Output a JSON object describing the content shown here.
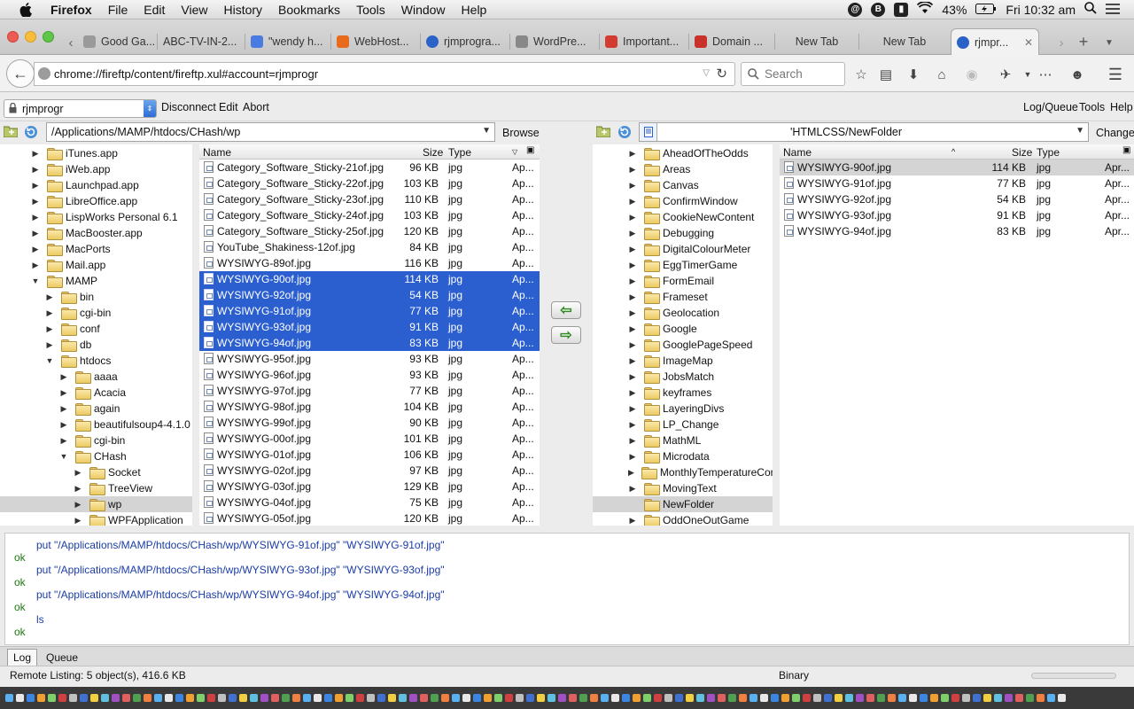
{
  "menubar": {
    "app": "Firefox",
    "items": [
      "File",
      "Edit",
      "View",
      "History",
      "Bookmarks",
      "Tools",
      "Window",
      "Help"
    ],
    "battery": "43%",
    "clock": "Fri 10:32 am"
  },
  "tabs": [
    {
      "label": "Good Ga...",
      "color": "#999999"
    },
    {
      "label": "ABC-TV-IN-2...",
      "color": "#aaaaaa"
    },
    {
      "label": "\"wendy h...",
      "color": "#4a7be0"
    },
    {
      "label": "WebHost...",
      "color": "#e86a1c"
    },
    {
      "label": "rjmprogra...",
      "color": "#2a62c8"
    },
    {
      "label": "WordPre...",
      "color": "#888888"
    },
    {
      "label": "Important...",
      "color": "#d23b2f"
    },
    {
      "label": "Domain ...",
      "color": "#c8322a"
    },
    {
      "label": "New Tab",
      "color": ""
    },
    {
      "label": "New Tab",
      "color": ""
    },
    {
      "label": "rjmpr...",
      "color": "#2a62c8"
    }
  ],
  "nav": {
    "url": "chrome://fireftp/content/fireftp.xul#account=rjmprogr",
    "search_placeholder": "Search"
  },
  "toolbar": {
    "account": "rjmprogr",
    "disconnect": "Disconnect",
    "edit": "Edit",
    "abort": "Abort",
    "logqueue": "Log/Queue",
    "tools": "Tools",
    "help": "Help"
  },
  "local": {
    "path": "/Applications/MAMP/htdocs/CHash/wp",
    "browse": "Browse",
    "tree": [
      {
        "label": "iTunes.app",
        "level": 0,
        "state": "closed"
      },
      {
        "label": "iWeb.app",
        "level": 0,
        "state": "closed"
      },
      {
        "label": "Launchpad.app",
        "level": 0,
        "state": "closed"
      },
      {
        "label": "LibreOffice.app",
        "level": 0,
        "state": "closed"
      },
      {
        "label": "LispWorks Personal 6.1",
        "level": 0,
        "state": "closed"
      },
      {
        "label": "MacBooster.app",
        "level": 0,
        "state": "closed"
      },
      {
        "label": "MacPorts",
        "level": 0,
        "state": "closed"
      },
      {
        "label": "Mail.app",
        "level": 0,
        "state": "closed"
      },
      {
        "label": "MAMP",
        "level": 0,
        "state": "open"
      },
      {
        "label": "bin",
        "level": 1,
        "state": "closed"
      },
      {
        "label": "cgi-bin",
        "level": 1,
        "state": "closed"
      },
      {
        "label": "conf",
        "level": 1,
        "state": "closed"
      },
      {
        "label": "db",
        "level": 1,
        "state": "closed"
      },
      {
        "label": "htdocs",
        "level": 1,
        "state": "open"
      },
      {
        "label": "aaaa",
        "level": 2,
        "state": "closed"
      },
      {
        "label": "Acacia",
        "level": 2,
        "state": "closed"
      },
      {
        "label": "again",
        "level": 2,
        "state": "closed"
      },
      {
        "label": "beautifulsoup4-4.1.0",
        "level": 2,
        "state": "closed"
      },
      {
        "label": "cgi-bin",
        "level": 2,
        "state": "closed"
      },
      {
        "label": "CHash",
        "level": 2,
        "state": "open"
      },
      {
        "label": "Socket",
        "level": 3,
        "state": "closed"
      },
      {
        "label": "TreeView",
        "level": 3,
        "state": "closed"
      },
      {
        "label": "wp",
        "level": 3,
        "state": "closed",
        "current": true
      },
      {
        "label": "WPFApplication",
        "level": 3,
        "state": "closed"
      }
    ],
    "headers": {
      "name": "Name",
      "size": "Size",
      "type": "Type"
    },
    "files": [
      {
        "name": "Category_Software_Sticky-21of.jpg",
        "size": "96 KB",
        "type": "jpg",
        "date": "Ap...",
        "selected": false
      },
      {
        "name": "Category_Software_Sticky-22of.jpg",
        "size": "103 KB",
        "type": "jpg",
        "date": "Ap...",
        "selected": false
      },
      {
        "name": "Category_Software_Sticky-23of.jpg",
        "size": "110 KB",
        "type": "jpg",
        "date": "Ap...",
        "selected": false
      },
      {
        "name": "Category_Software_Sticky-24of.jpg",
        "size": "103 KB",
        "type": "jpg",
        "date": "Ap...",
        "selected": false
      },
      {
        "name": "Category_Software_Sticky-25of.jpg",
        "size": "120 KB",
        "type": "jpg",
        "date": "Ap...",
        "selected": false
      },
      {
        "name": "YouTube_Shakiness-12of.jpg",
        "size": "84 KB",
        "type": "jpg",
        "date": "Ap...",
        "selected": false
      },
      {
        "name": "WYSIWYG-89of.jpg",
        "size": "116 KB",
        "type": "jpg",
        "date": "Ap...",
        "selected": false
      },
      {
        "name": "WYSIWYG-90of.jpg",
        "size": "114 KB",
        "type": "jpg",
        "date": "Ap...",
        "selected": true
      },
      {
        "name": "WYSIWYG-92of.jpg",
        "size": "54 KB",
        "type": "jpg",
        "date": "Ap...",
        "selected": true
      },
      {
        "name": "WYSIWYG-91of.jpg",
        "size": "77 KB",
        "type": "jpg",
        "date": "Ap...",
        "selected": true
      },
      {
        "name": "WYSIWYG-93of.jpg",
        "size": "91 KB",
        "type": "jpg",
        "date": "Ap...",
        "selected": true
      },
      {
        "name": "WYSIWYG-94of.jpg",
        "size": "83 KB",
        "type": "jpg",
        "date": "Ap...",
        "selected": true
      },
      {
        "name": "WYSIWYG-95of.jpg",
        "size": "93 KB",
        "type": "jpg",
        "date": "Ap...",
        "selected": false
      },
      {
        "name": "WYSIWYG-96of.jpg",
        "size": "93 KB",
        "type": "jpg",
        "date": "Ap...",
        "selected": false
      },
      {
        "name": "WYSIWYG-97of.jpg",
        "size": "77 KB",
        "type": "jpg",
        "date": "Ap...",
        "selected": false
      },
      {
        "name": "WYSIWYG-98of.jpg",
        "size": "104 KB",
        "type": "jpg",
        "date": "Ap...",
        "selected": false
      },
      {
        "name": "WYSIWYG-99of.jpg",
        "size": "90 KB",
        "type": "jpg",
        "date": "Ap...",
        "selected": false
      },
      {
        "name": "WYSIWYG-00of.jpg",
        "size": "101 KB",
        "type": "jpg",
        "date": "Ap...",
        "selected": false
      },
      {
        "name": "WYSIWYG-01of.jpg",
        "size": "106 KB",
        "type": "jpg",
        "date": "Ap...",
        "selected": false
      },
      {
        "name": "WYSIWYG-02of.jpg",
        "size": "97 KB",
        "type": "jpg",
        "date": "Ap...",
        "selected": false
      },
      {
        "name": "WYSIWYG-03of.jpg",
        "size": "129 KB",
        "type": "jpg",
        "date": "Ap...",
        "selected": false
      },
      {
        "name": "WYSIWYG-04of.jpg",
        "size": "75 KB",
        "type": "jpg",
        "date": "Ap...",
        "selected": false
      },
      {
        "name": "WYSIWYG-05of.jpg",
        "size": "120 KB",
        "type": "jpg",
        "date": "Ap...",
        "selected": false
      }
    ]
  },
  "remote": {
    "path": "'HTMLCSS/NewFolder",
    "change": "Change",
    "tree": [
      {
        "label": "AheadOfTheOdds",
        "state": "closed"
      },
      {
        "label": "Areas",
        "state": "closed"
      },
      {
        "label": "Canvas",
        "state": "closed"
      },
      {
        "label": "ConfirmWindow",
        "state": "closed"
      },
      {
        "label": "CookieNewContent",
        "state": "closed"
      },
      {
        "label": "Debugging",
        "state": "closed"
      },
      {
        "label": "DigitalColourMeter",
        "state": "closed"
      },
      {
        "label": "EggTimerGame",
        "state": "closed"
      },
      {
        "label": "FormEmail",
        "state": "closed"
      },
      {
        "label": "Frameset",
        "state": "closed"
      },
      {
        "label": "Geolocation",
        "state": "closed"
      },
      {
        "label": "Google",
        "state": "closed"
      },
      {
        "label": "GooglePageSpeed",
        "state": "closed"
      },
      {
        "label": "ImageMap",
        "state": "closed"
      },
      {
        "label": "JobsMatch",
        "state": "closed"
      },
      {
        "label": "keyframes",
        "state": "closed"
      },
      {
        "label": "LayeringDivs",
        "state": "closed"
      },
      {
        "label": "LP_Change",
        "state": "closed"
      },
      {
        "label": "MathML",
        "state": "closed"
      },
      {
        "label": "Microdata",
        "state": "closed"
      },
      {
        "label": "MonthlyTemperatureCom",
        "state": "closed"
      },
      {
        "label": "MovingText",
        "state": "closed"
      },
      {
        "label": "NewFolder",
        "state": "none",
        "current": true
      },
      {
        "label": "OddOneOutGame",
        "state": "closed"
      }
    ],
    "headers": {
      "name": "Name",
      "size": "Size",
      "type": "Type"
    },
    "files": [
      {
        "name": "WYSIWYG-90of.jpg",
        "size": "114 KB",
        "type": "jpg",
        "date": "Apr...",
        "highlighted": true
      },
      {
        "name": "WYSIWYG-91of.jpg",
        "size": "77 KB",
        "type": "jpg",
        "date": "Apr...",
        "highlighted": false
      },
      {
        "name": "WYSIWYG-92of.jpg",
        "size": "54 KB",
        "type": "jpg",
        "date": "Apr...",
        "highlighted": false
      },
      {
        "name": "WYSIWYG-93of.jpg",
        "size": "91 KB",
        "type": "jpg",
        "date": "Apr...",
        "highlighted": false
      },
      {
        "name": "WYSIWYG-94of.jpg",
        "size": "83 KB",
        "type": "jpg",
        "date": "Apr...",
        "highlighted": false
      }
    ]
  },
  "log": [
    {
      "kind": "cmd",
      "text": "put \"/Applications/MAMP/htdocs/CHash/wp/WYSIWYG-91of.jpg\" \"WYSIWYG-91of.jpg\""
    },
    {
      "kind": "ok",
      "text": "ok"
    },
    {
      "kind": "cmd",
      "text": "put \"/Applications/MAMP/htdocs/CHash/wp/WYSIWYG-93of.jpg\" \"WYSIWYG-93of.jpg\""
    },
    {
      "kind": "ok",
      "text": "ok"
    },
    {
      "kind": "cmd",
      "text": "put \"/Applications/MAMP/htdocs/CHash/wp/WYSIWYG-94of.jpg\" \"WYSIWYG-94of.jpg\""
    },
    {
      "kind": "ok",
      "text": "ok"
    },
    {
      "kind": "cmd",
      "text": "ls"
    },
    {
      "kind": "ok",
      "text": "ok"
    }
  ],
  "logtabs": {
    "log": "Log",
    "queue": "Queue"
  },
  "status": {
    "left": "Remote Listing: 5 object(s), 416.6 KB",
    "mode": "Binary"
  },
  "colors": {
    "selection": "#2b5fd0",
    "log_cmd": "#1b3da8",
    "log_ok": "#1d7a10",
    "arrow": "#2f8b22"
  }
}
